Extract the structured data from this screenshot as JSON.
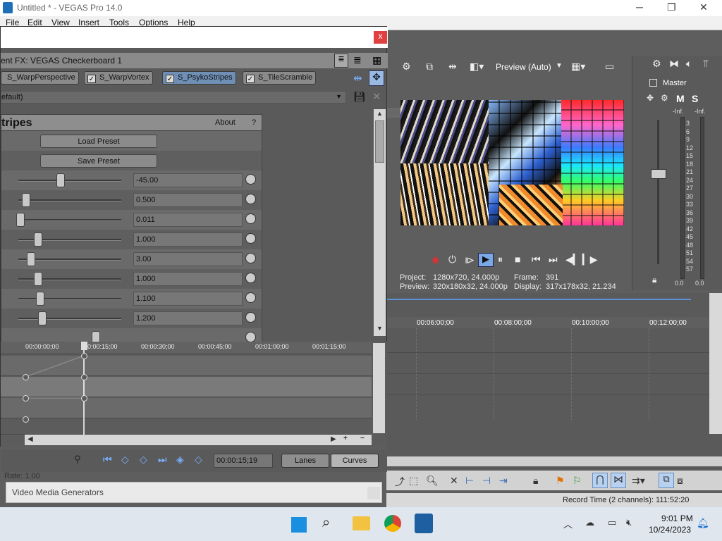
{
  "window": {
    "title": "Untitled * - VEGAS Pro 14.0",
    "min": "─",
    "max": "❐",
    "close": "✕"
  },
  "menu": [
    "File",
    "Edit",
    "View",
    "Insert",
    "Tools",
    "Options",
    "Help"
  ],
  "fx": {
    "close_label": "x",
    "chain_label": "ent FX:  VEGAS Checkerboard 1",
    "plugins": [
      "S_WarpPerspective",
      "S_WarpVortex",
      "S_PsykoStripes",
      "S_TileScramble"
    ],
    "selected_plugin": "S_PsykoStripes",
    "preset": "efault)",
    "plugin_name": "tripes",
    "about": "About",
    "help": "?",
    "load_preset": "Load Preset",
    "save_preset": "Save Preset",
    "delete_tooltip": "Delete",
    "params": [
      {
        "value": "-45.00",
        "pos": 0.43
      },
      {
        "value": "0.500",
        "pos": 0.08
      },
      {
        "value": "0.011",
        "pos": 0.02
      },
      {
        "value": "1.000",
        "pos": 0.2
      },
      {
        "value": "3.00",
        "pos": 0.13
      },
      {
        "value": "1.000",
        "pos": 0.2
      },
      {
        "value": "1.100",
        "pos": 0.22
      },
      {
        "value": "1.200",
        "pos": 0.24
      }
    ]
  },
  "keyframes": {
    "ruler": [
      "00:00:00;00",
      "00:00:15;00",
      "00:00:30;00",
      "00:00:45;00",
      "00:01:00;00",
      "00:01:15;00"
    ],
    "time": "00:00:15;19",
    "lanes_btn": "Lanes",
    "curves_btn": "Curves",
    "rate_label": "Rate: 1.00"
  },
  "media_generators": "Video Media Generators",
  "preview": {
    "mode": "Preview (Auto)",
    "project_label": "Project:",
    "project_value": "1280x720, 24.000p",
    "preview_label": "Preview:",
    "preview_value": "320x180x32, 24.000p",
    "frame_label": "Frame:",
    "frame_value": "391",
    "display_label": "Display:",
    "display_value": "317x178x32, 21.234"
  },
  "mixer": {
    "master": "Master",
    "m": "M",
    "s": "S",
    "inf_l": "-Inf.",
    "inf_r": "-Inf.",
    "scale": [
      "3",
      "6",
      "9",
      "12",
      "15",
      "18",
      "21",
      "24",
      "27",
      "30",
      "33",
      "36",
      "39",
      "42",
      "45",
      "48",
      "51",
      "54",
      "57"
    ],
    "bottom_l": "0.0",
    "bottom_r": "0.0"
  },
  "timeline": {
    "times": [
      "00:06:00;00",
      "00:08:00;00",
      "00:10:00;00",
      "00:12:00;00"
    ]
  },
  "status": {
    "record_time": "Record Time (2 channels): 111:52:20"
  },
  "taskbar": {
    "time": "9:01 PM",
    "date": "10/24/2023"
  }
}
